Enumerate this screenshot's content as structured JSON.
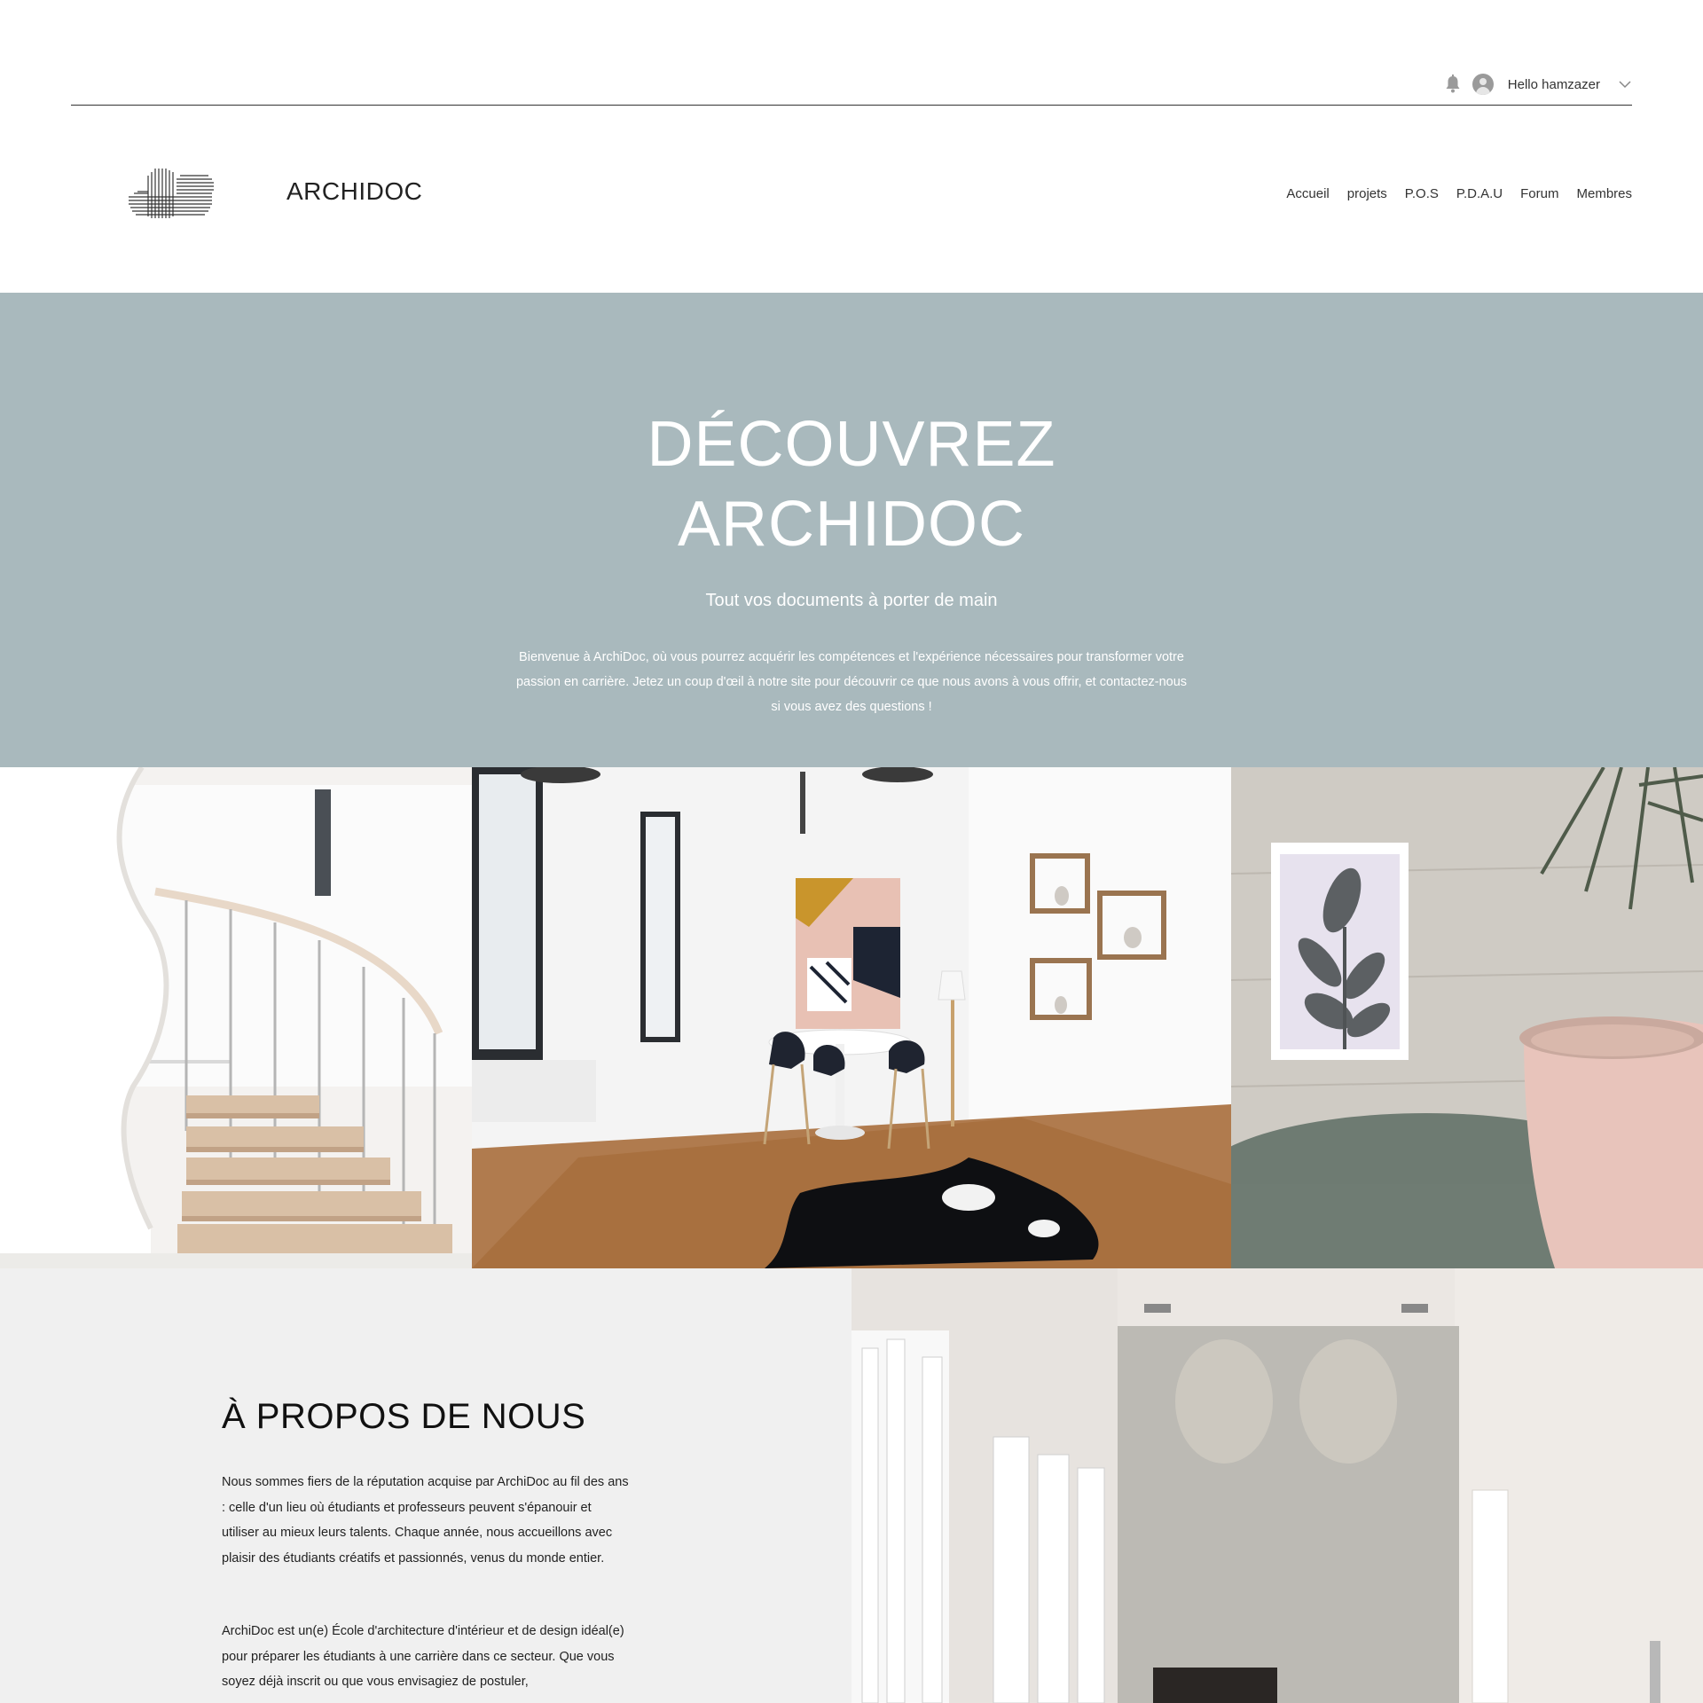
{
  "user": {
    "greeting": "Hello hamzazer"
  },
  "header": {
    "brand": "ARCHIDOC",
    "nav": [
      "Accueil",
      "projets",
      "P.O.S",
      "P.D.A.U",
      "Forum",
      "Membres"
    ]
  },
  "hero": {
    "title_line1": "DÉCOUVREZ",
    "title_line2": "ARCHIDOC",
    "subtitle": "Tout vos documents à porter de main",
    "text_line1": "Bienvenue à ArchiDoc, où vous pourrez acquérir les compétences et l'expérience nécessaires pour transformer votre",
    "text_line2": "passion en carrière. Jetez un coup d'œil à notre site pour découvrir ce que nous avons à vous offrir, et contactez-nous",
    "text_line3": "si vous avez des questions !"
  },
  "about": {
    "title": "À PROPOS DE NOUS",
    "p1": "Nous sommes fiers de la réputation acquise par ArchiDoc au fil des ans : celle d'un lieu où étudiants et professeurs peuvent s'épanouir et utiliser au mieux leurs talents. Chaque année, nous accueillons avec plaisir des étudiants créatifs et passionnés, venus du monde entier.",
    "p2": "ArchiDoc est un(e) École d'architecture d'intérieur et de design idéal(e) pour préparer les étudiants à une carrière dans ce secteur. Que vous soyez déjà inscrit ou que vous envisagiez de postuler,"
  },
  "icons": {
    "notifications": "bell-icon",
    "profile": "avatar-icon",
    "menu": "chevron-down-icon",
    "logo": "building-logo"
  },
  "colors": {
    "hero_bg": "#a9b9bd",
    "about_bg": "#f0f0f0",
    "text": "#222222"
  }
}
